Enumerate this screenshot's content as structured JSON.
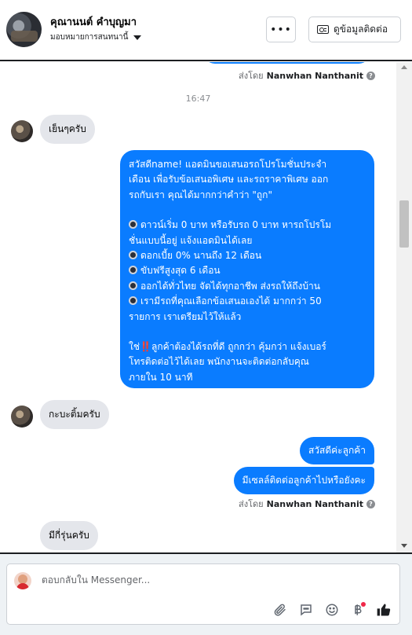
{
  "header": {
    "contact_name": "คุณานนต์ คำบุญมา",
    "assign_label": "มอบหมายการสนทนานี้",
    "more_label": "•••",
    "info_button_label": "ดูข้อมูลติดต่อ"
  },
  "conversation": {
    "sent_by_prefix": "ส่งโดย",
    "sent_by_name": "Nanwhan Nanthanit",
    "timestamp": "16:47",
    "messages": [
      {
        "text": "เย็นๆครับ"
      },
      {
        "lines": [
          "สวัสดีname! แอดมินขอเสนอรถโปรโมชั่นประจำ",
          "เดือน เพื่อรับข้อเสนอพิเศษ และรถราคาพิเศษ ออก",
          "รถกับเรา คุณได้มากกว่าคำว่า \"ถูก\"",
          "",
          "ดาวน์เริ่ม 0 บาท หรือรับรถ 0 บาท หารถโปรโม",
          "ชั่นแบบนี้อยู่ แจ้งแอดมินได้เลย",
          "ดอกเบี้ย 0% นานถึง 12 เดือน",
          "ขับฟรีสูงสุด 6 เดือน",
          "ออกได้ทั่วไทย จัดได้ทุกอาชีพ ส่งรถให้ถึงบ้าน",
          "เรามีรถที่คุณเลือกข้อเสนอเองได้ มากกว่า 50",
          "รายการ เราเตรียมไว้ให้แล้ว",
          "",
          "ใช่",
          "ลูกค้าต้องได้รถที่ดี ถูกกว่า คุ้มกว่า แจ้งเบอร์",
          "โทรติดต่อไว้ได้เลย พนักงานจะติดต่อกลับคุณ",
          "ภายใน 10 นาที"
        ],
        "bang": "‼️"
      },
      {
        "text": "กะบะติ้มครับ"
      },
      {
        "text": "สวัสดีค่ะลูกค้า"
      },
      {
        "text": "มีเซลล์ติดต่อลูกค้าไปหรือยังคะ"
      },
      {
        "text": "มีกี่รุ่นครับ"
      }
    ]
  },
  "composer": {
    "placeholder": "ตอบกลับใน Messenger..."
  },
  "icons": {
    "attach": "paperclip-icon",
    "saved_replies": "chat-bubble-icon",
    "emoji": "smiley-icon",
    "payment": "baht-icon",
    "like": "thumbs-up-icon"
  },
  "colors": {
    "accent": "#0a7cff",
    "incoming_bubble": "#e4e6eb",
    "notification": "#f02849"
  }
}
